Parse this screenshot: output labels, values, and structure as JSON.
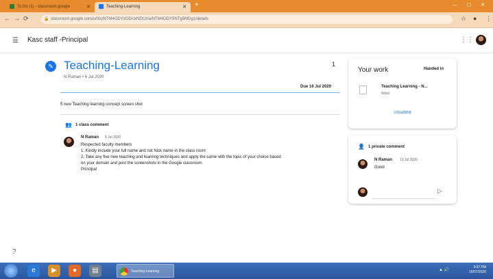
{
  "browser": {
    "tabs": [
      {
        "label": "To Do (1) - classroom.google",
        "active": false
      },
      {
        "label": "Teaching-Learning",
        "active": true
      }
    ],
    "url": "classroom.google.com/u/0/c/NTM4ODYzODUxNDUz/a/NTM4ODY5NTg5MDg1/details"
  },
  "header": {
    "class_name": "Kasc staff -Principal"
  },
  "assignment": {
    "title": "Teaching-Learning",
    "meta": "N Raman • 6 Jul 2020",
    "points": "1",
    "due": "Due 16 Jul 2020",
    "instructions": "5 new Teaching learning concept screen shot"
  },
  "class_comments": {
    "label": "1 class comment",
    "comment": {
      "author": "N Raman",
      "date": "5 Jul 2020",
      "lines": [
        "Respected faculty members",
        "1. Kindly include your full name and not Nick name in the class room",
        "2. Take any five new teaching and learning techniques and apply the same with the topic of your choice based",
        "on your domain and post the screenshots in the Google classroom.",
        "Principal"
      ]
    }
  },
  "your_work": {
    "title": "Your work",
    "status": "Handed in",
    "attachment_name": "Teaching Learning - N...",
    "attachment_type": "Word",
    "unsubmit_label": "Unsubmit"
  },
  "private_comments": {
    "label": "1 private comment",
    "author": "N Raman",
    "date": "13 Jul 2020",
    "text": "Good",
    "input_placeholder": ""
  },
  "taskbar": {
    "active_window": "Teaching-Learning",
    "time": "3:07 PM",
    "date": "16/07/2020"
  },
  "colors": {
    "accent": "#1a73e8",
    "tab_bar": "#e88a2e",
    "taskbar": "#2a56a0"
  }
}
